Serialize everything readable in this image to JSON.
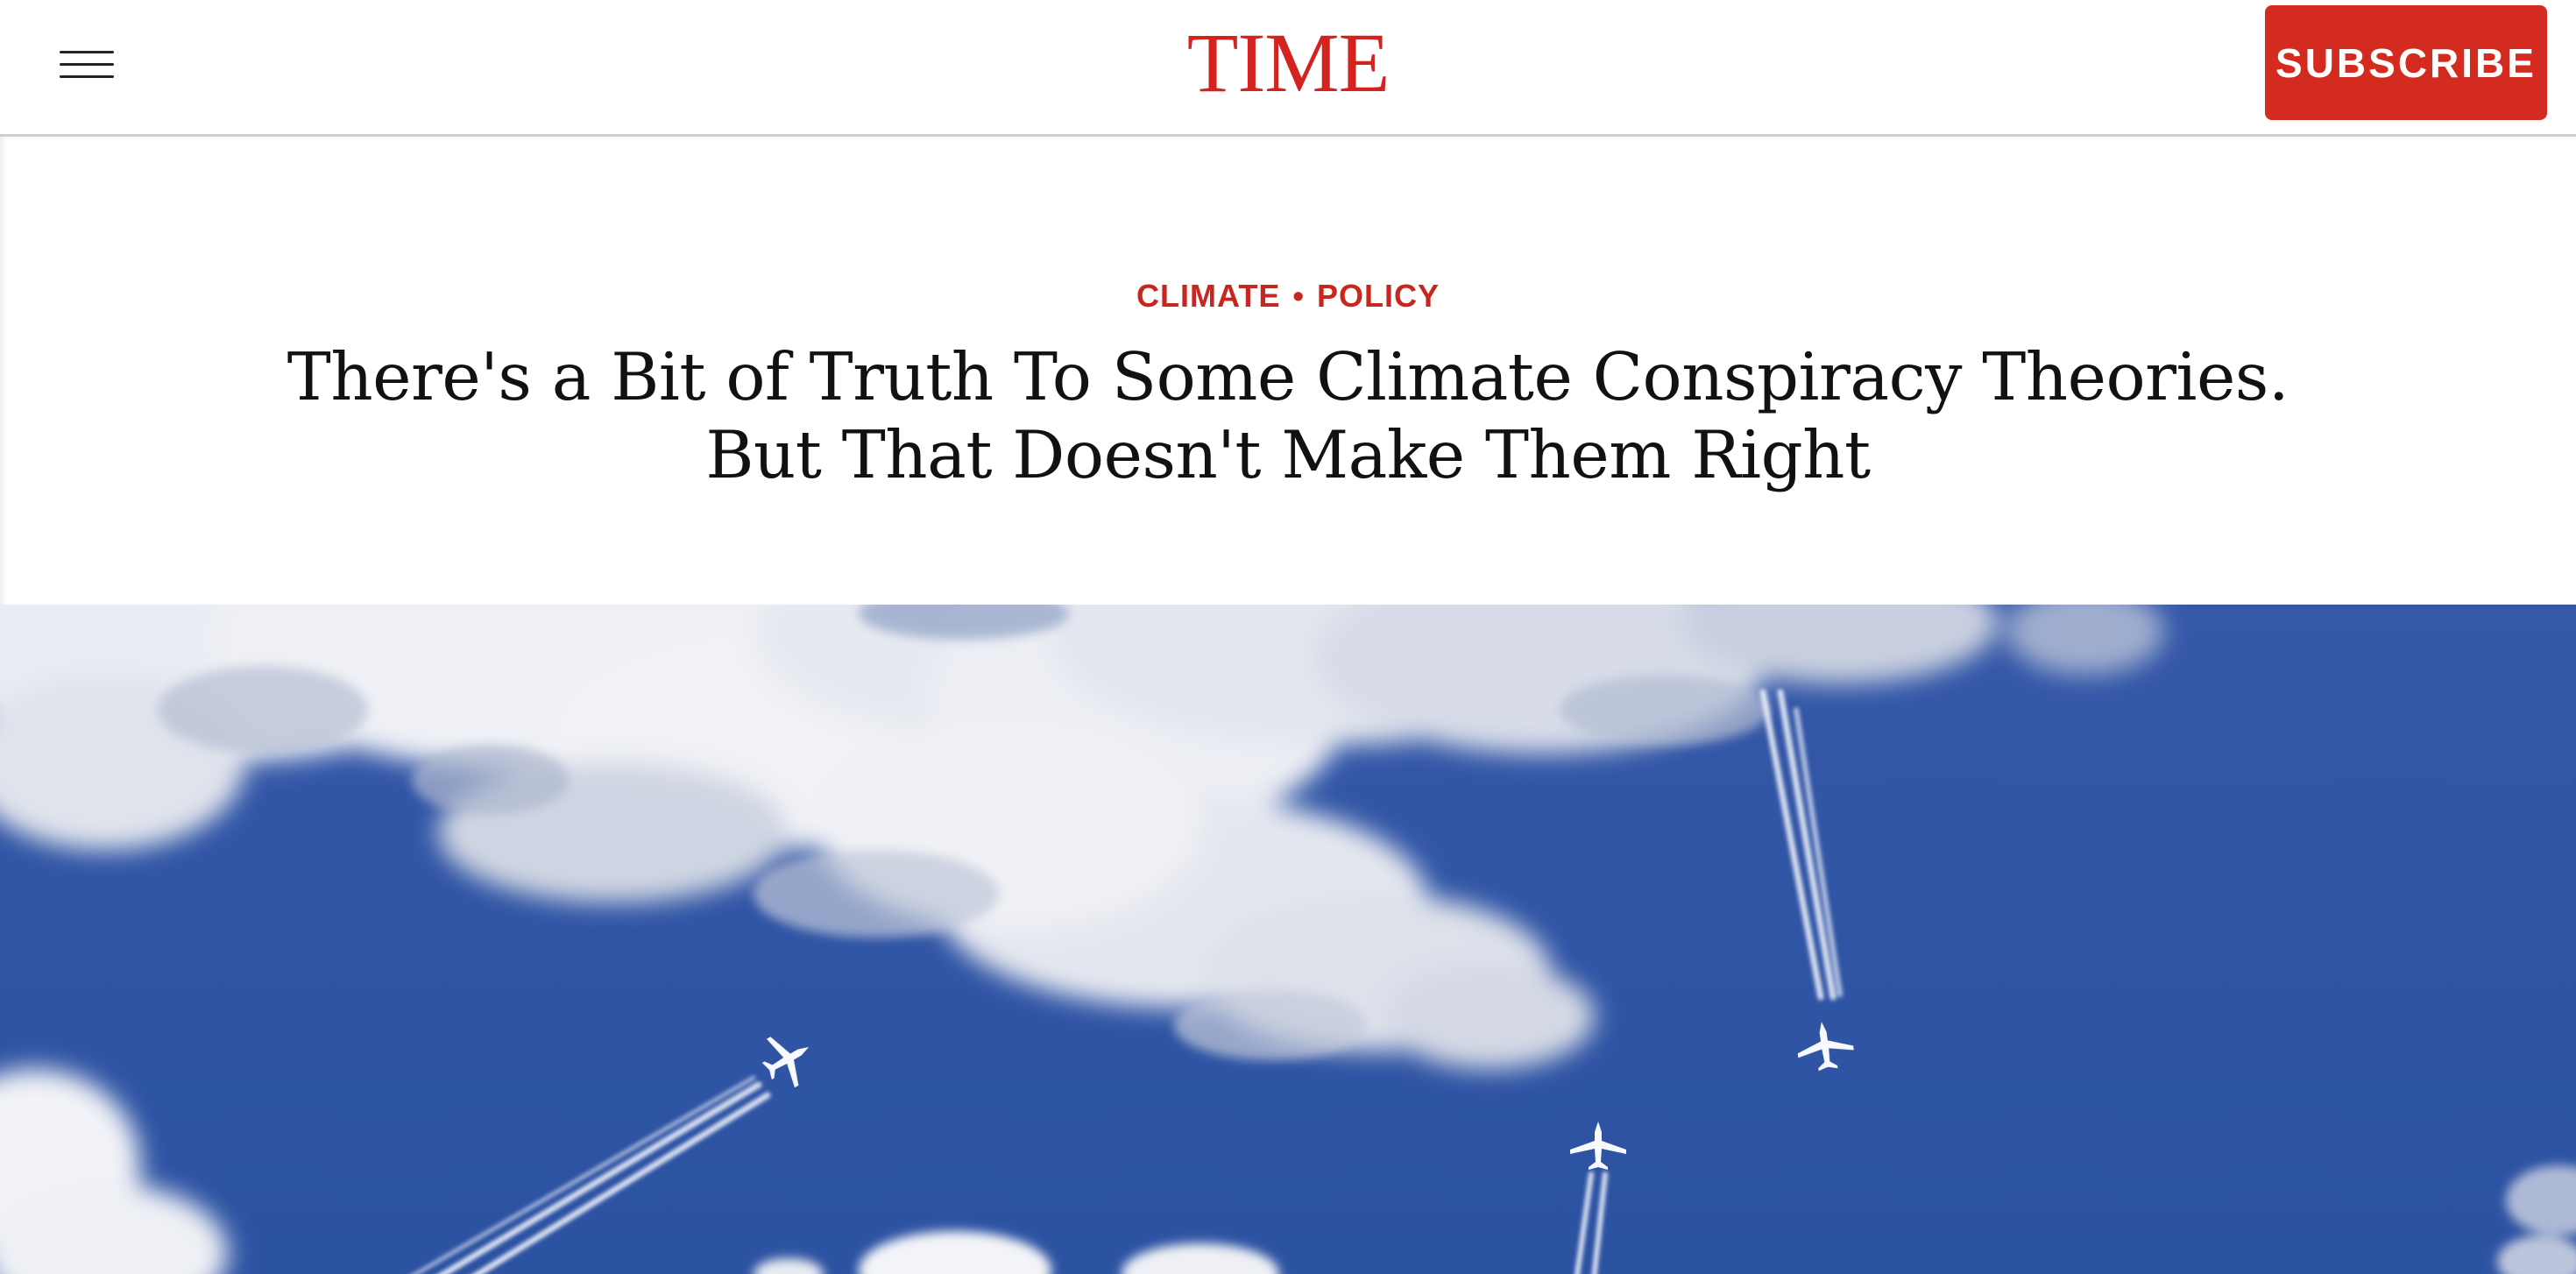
{
  "header": {
    "logo": "TIME",
    "subscribe_label": "SUBSCRIBE",
    "menu_icon": "hamburger-menu-icon"
  },
  "article": {
    "topics": [
      "CLIMATE",
      "POLICY"
    ],
    "topic_separator": "•",
    "headline_line1": "There's a Bit of Truth To Some Climate Conspiracy Theories.",
    "headline_line2": "But That Doesn't Make Them Right"
  },
  "colors": {
    "brand_red": "#d42b20",
    "sky_blue": "#2f56a6",
    "headline": "#111111"
  }
}
